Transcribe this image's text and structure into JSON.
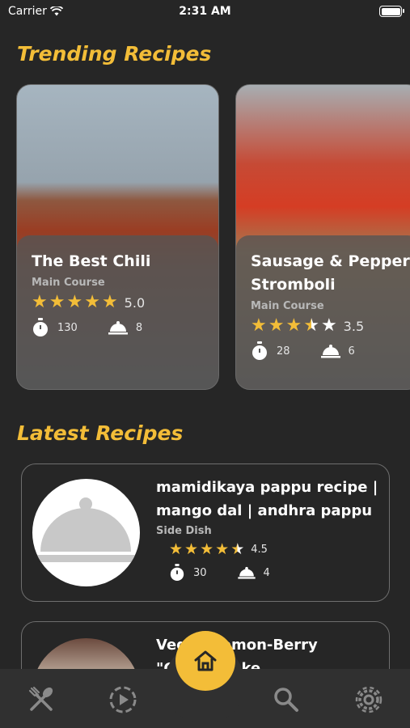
{
  "status_bar": {
    "carrier": "Carrier",
    "time": "2:31 AM"
  },
  "trending": {
    "title": "Trending Recipes",
    "cards": [
      {
        "title": "The Best Chili",
        "category": "Main Course",
        "rating": 5.0,
        "rating_text": "5.0",
        "time": "130",
        "servings": "8"
      },
      {
        "title_line1": "Sausage & Pepperoni",
        "title_line2": "Stromboli",
        "category": "Main Course",
        "rating": 3.5,
        "rating_text": "3.5",
        "time": "28",
        "servings": "6"
      }
    ]
  },
  "latest": {
    "title": "Latest Recipes",
    "items": [
      {
        "title_line1": "mamidikaya pappu recipe |",
        "title_line2": "mango dal | andhra pappu",
        "category": "Side Dish",
        "rating": 4.5,
        "rating_text": "4.5",
        "time": "30",
        "servings": "4"
      },
      {
        "title_line1": "Vegan Lemon-Berry",
        "title_line2": "\"Cheesecake"
      }
    ]
  },
  "tab_bar": {
    "items": [
      "recipes-icon",
      "play-icon",
      "home-icon",
      "search-icon",
      "settings-icon"
    ]
  },
  "colors": {
    "accent": "#f3bd38",
    "background": "#262626"
  }
}
